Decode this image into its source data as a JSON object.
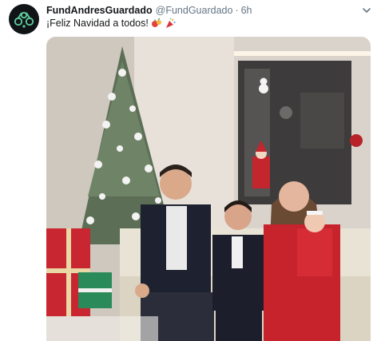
{
  "tweet": {
    "display_name": "FundAndresGuardado",
    "handle": "@FundGuardado",
    "separator": "·",
    "time": "6h",
    "text": "¡Feliz Navidad a todos!",
    "emojis": [
      "christmas-ornament-emoji",
      "party-popper-emoji"
    ],
    "media": {
      "type": "video-frame",
      "description_icon": "family-christmas-photo"
    }
  },
  "colors": {
    "display_name": "#14171a",
    "secondary_text": "#657786",
    "avatar_bg": "#111417",
    "avatar_logo": "#5fd0a0",
    "caret": "#657786"
  }
}
